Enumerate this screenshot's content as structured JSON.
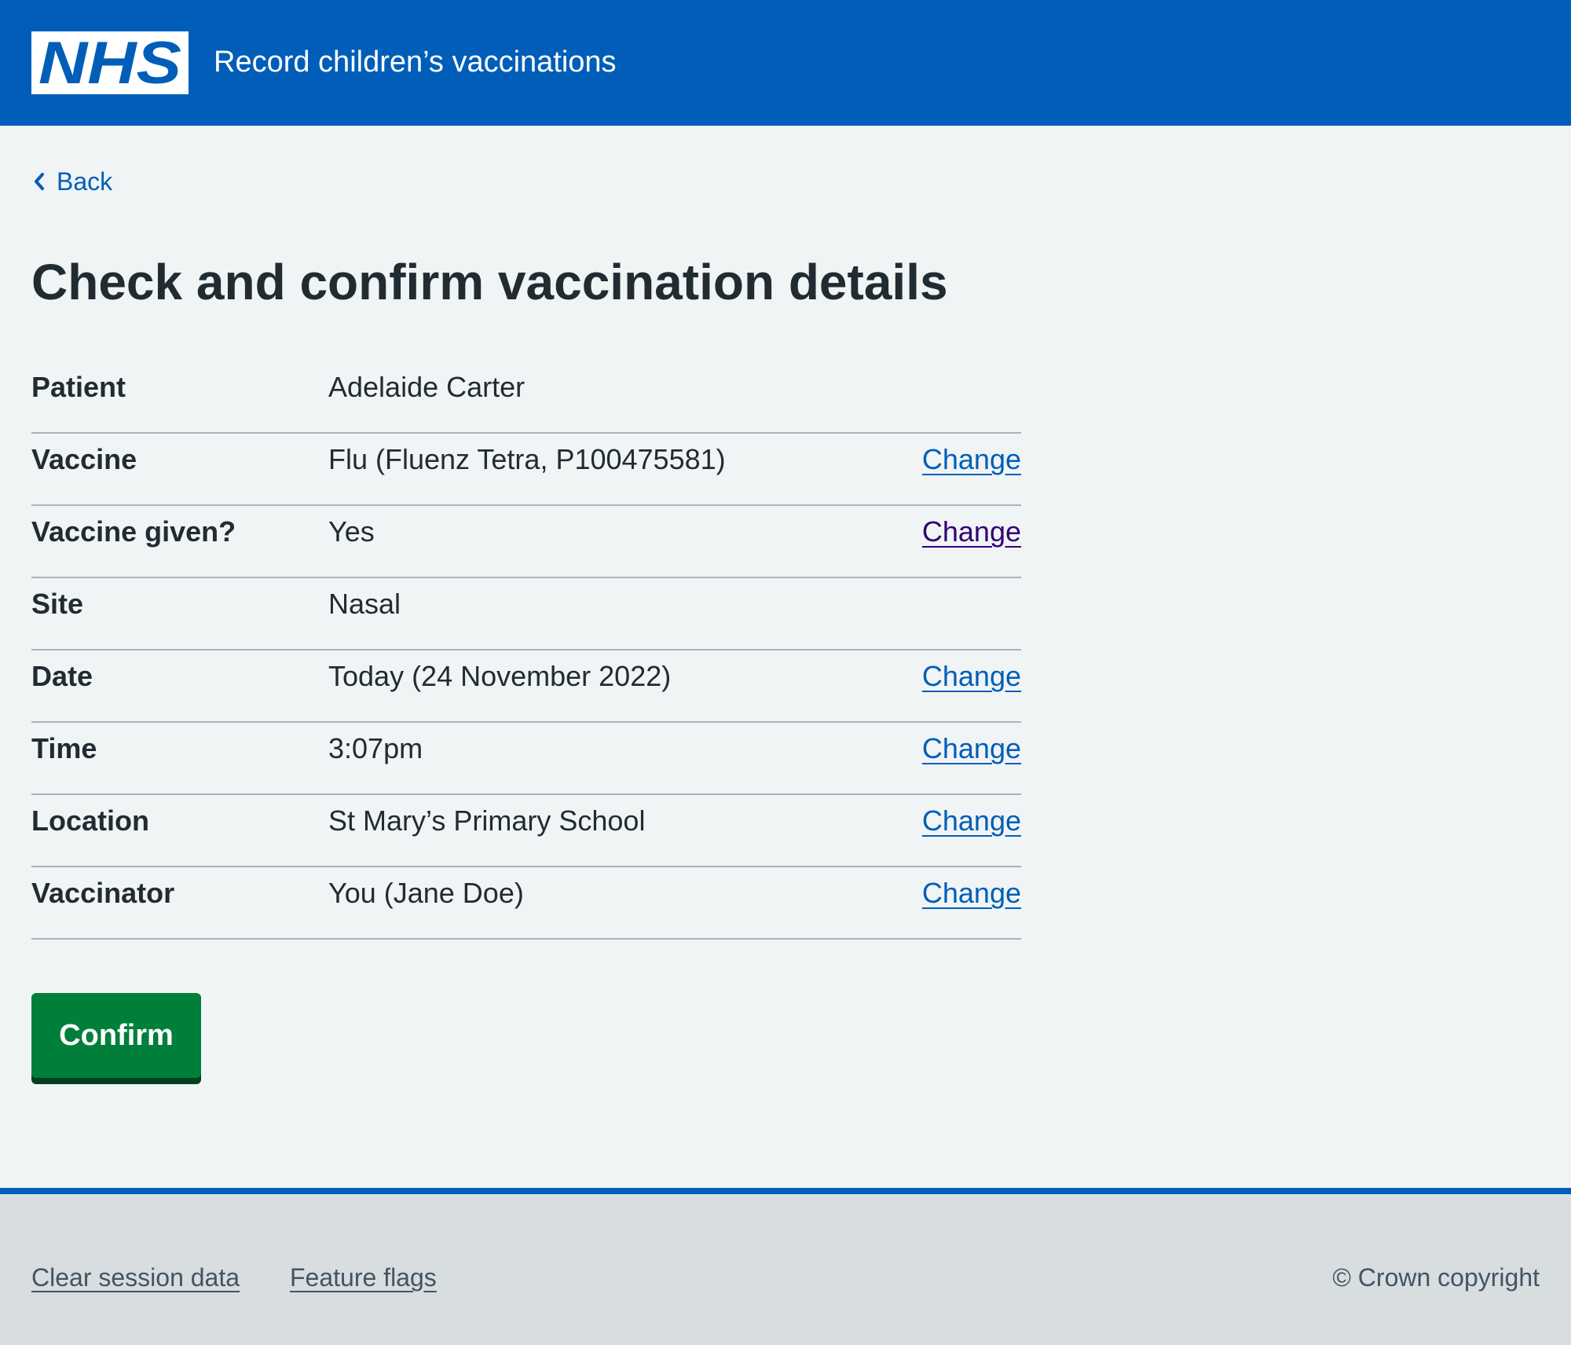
{
  "header": {
    "logo_text": "NHS",
    "service_name": "Record children’s vaccinations"
  },
  "back_link": {
    "label": "Back",
    "icon": "chevron-left-icon"
  },
  "page_title": "Check and confirm vaccination details",
  "summary": {
    "rows": [
      {
        "key": "Patient",
        "value": "Adelaide Carter",
        "action": ""
      },
      {
        "key": "Vaccine",
        "value": "Flu (Fluenz Tetra, P100475581)",
        "action": "Change"
      },
      {
        "key": "Vaccine given?",
        "value": "Yes",
        "action": "Change"
      },
      {
        "key": "Site",
        "value": "Nasal",
        "action": ""
      },
      {
        "key": "Date",
        "value": "Today (24 November 2022)",
        "action": "Change"
      },
      {
        "key": "Time",
        "value": "3:07pm",
        "action": "Change"
      },
      {
        "key": "Location",
        "value": "St Mary’s Primary School",
        "action": "Change"
      },
      {
        "key": "Vaccinator",
        "value": "You (Jane Doe)",
        "action": "Change"
      }
    ]
  },
  "confirm_button": "Confirm",
  "footer": {
    "links": [
      "Clear session data",
      "Feature flags"
    ],
    "copyright": "© Crown copyright"
  },
  "colors": {
    "header_blue": "#005eb8",
    "page_background": "#f0f4f5",
    "text": "#212b32",
    "link": "#005eb8",
    "visited_link": "#330072",
    "button_green": "#007f3b",
    "footer_background": "#d8dde0",
    "footer_text": "#425563"
  }
}
